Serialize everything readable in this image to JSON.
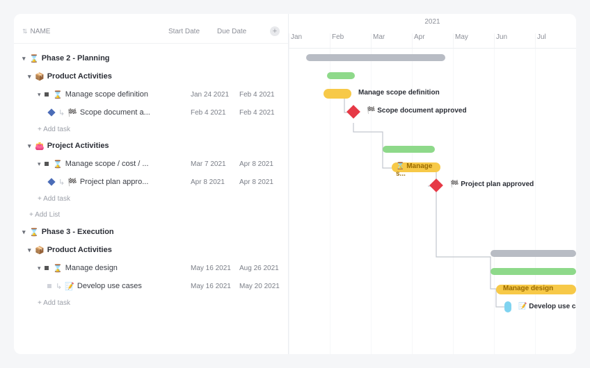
{
  "year": "2021",
  "months": [
    "Jan",
    "Feb",
    "Mar",
    "Apr",
    "May",
    "Jun",
    "Jul"
  ],
  "columns": {
    "name": "NAME",
    "start": "Start Date",
    "due": "Due Date"
  },
  "phases": [
    {
      "id": "phase2",
      "icon": "⌛",
      "title": "Phase 2 - Planning",
      "groups": [
        {
          "id": "p2-product",
          "icon": "📦",
          "title": "Product Activities",
          "tasks": [
            {
              "icon": "⌛",
              "title": "Manage scope definition",
              "start": "Jan 24 2021",
              "due": "Feb 4 2021",
              "subs": [
                {
                  "icon": "🏁",
                  "title": "Scope document a...",
                  "start": "Feb 4 2021",
                  "due": "Feb 4 2021"
                }
              ]
            }
          ],
          "add": "+ Add task"
        },
        {
          "id": "p2-project",
          "icon": "👛",
          "title": "Project Activities",
          "tasks": [
            {
              "icon": "⌛",
              "title": "Manage scope / cost / ...",
              "start": "Mar 7 2021",
              "due": "Apr 8 2021",
              "subs": [
                {
                  "icon": "🏁",
                  "title": "Project plan appro...",
                  "start": "Apr 8 2021",
                  "due": "Apr 8 2021"
                }
              ]
            }
          ],
          "add": "+ Add task"
        }
      ],
      "addList": "+ Add List"
    },
    {
      "id": "phase3",
      "icon": "⌛",
      "title": "Phase 3 - Execution",
      "groups": [
        {
          "id": "p3-product",
          "icon": "📦",
          "title": "Product Activities",
          "tasks": [
            {
              "icon": "⌛",
              "title": "Manage design",
              "start": "May 16 2021",
              "due": "Aug 26 2021",
              "subs": []
            },
            {
              "icon": "📝",
              "title": "Develop use cases",
              "start": "May 16 2021",
              "due": "May 20 2021",
              "subs": []
            }
          ],
          "add": "+ Add task"
        }
      ]
    }
  ],
  "gantt": {
    "labels": {
      "manage_scope": "Manage scope definition",
      "scope_doc": "🏁 Scope document approved",
      "manage_s": "⌛ Manage s...",
      "project_plan": "🏁 Project plan approved",
      "manage_design": "Manage design",
      "develop_use": "📝 Develop use cases"
    }
  }
}
